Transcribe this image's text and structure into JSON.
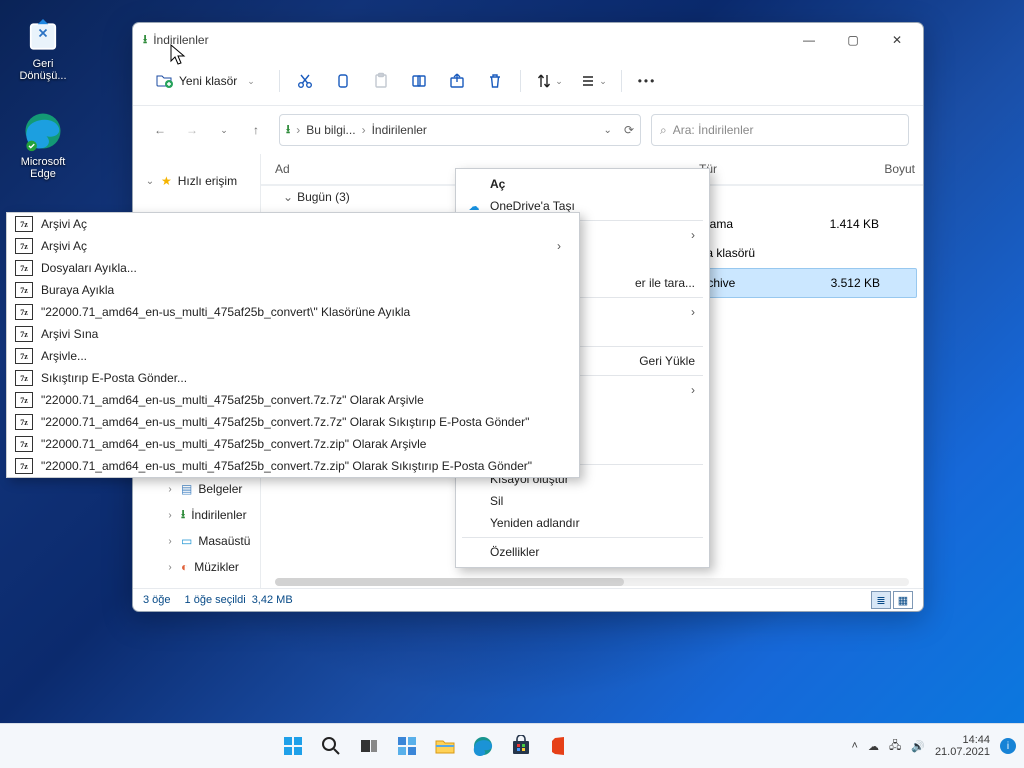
{
  "desktop": {
    "recycle_bin": "Geri Dönüşü...",
    "edge": "Microsoft Edge"
  },
  "window": {
    "title": "İndirilenler",
    "new_folder": "Yeni klasör",
    "breadcrumb": {
      "root": "Bu bilgi...",
      "leaf": "İndirilenler"
    },
    "search_placeholder": "Ara: İndirilenler",
    "nav": {
      "quick_access": "Hızlı erişim",
      "documents": "Belgeler",
      "downloads": "İndirilenler",
      "desktop": "Masaüstü",
      "music": "Müzikler"
    },
    "columns": {
      "name": "Ad",
      "type": "Tür",
      "size": "Boyut"
    },
    "group_today": "Bugün (3)",
    "rows": [
      {
        "type": "Uygulama",
        "size": "1.414 KB"
      },
      {
        "type": "Dosya klasörü",
        "size": ""
      },
      {
        "type": "7z Archive",
        "size": "3.512 KB"
      }
    ],
    "status": {
      "count": "3 öğe",
      "selected": "1 öğe seçildi",
      "size": "3,42 MB"
    }
  },
  "ctx_main": {
    "open": "Aç",
    "onedrive": "OneDrive'a Taşı",
    "scan": "er ile tara...",
    "restore": "Geri Yükle",
    "shortcut": "Kısayol oluştur",
    "delete": "Sil",
    "rename": "Yeniden adlandır",
    "properties": "Özellikler"
  },
  "ctx_7z": {
    "open1": "Arşivi Aç",
    "open2": "Arşivi Aç",
    "extract_files": "Dosyaları Ayıkla...",
    "extract_here": "Buraya Ayıkla",
    "extract_to": "\"22000.71_amd64_en-us_multi_475af25b_convert\\\" Klasörüne Ayıkla",
    "test": "Arşivi Sına",
    "archive": "Arşivle...",
    "compress_mail": "Sıkıştırıp E-Posta Gönder...",
    "as7z": "\"22000.71_amd64_en-us_multi_475af25b_convert.7z.7z\" Olarak Arşivle",
    "as7z_mail": "\"22000.71_amd64_en-us_multi_475af25b_convert.7z.7z\" Olarak Sıkıştırıp E-Posta Gönder\"",
    "aszip": "\"22000.71_amd64_en-us_multi_475af25b_convert.7z.zip\" Olarak Arşivle",
    "aszip_mail": "\"22000.71_amd64_en-us_multi_475af25b_convert.7z.zip\" Olarak Sıkıştırıp E-Posta Gönder\""
  },
  "taskbar": {
    "time": "14:44",
    "date": "21.07.2021"
  }
}
